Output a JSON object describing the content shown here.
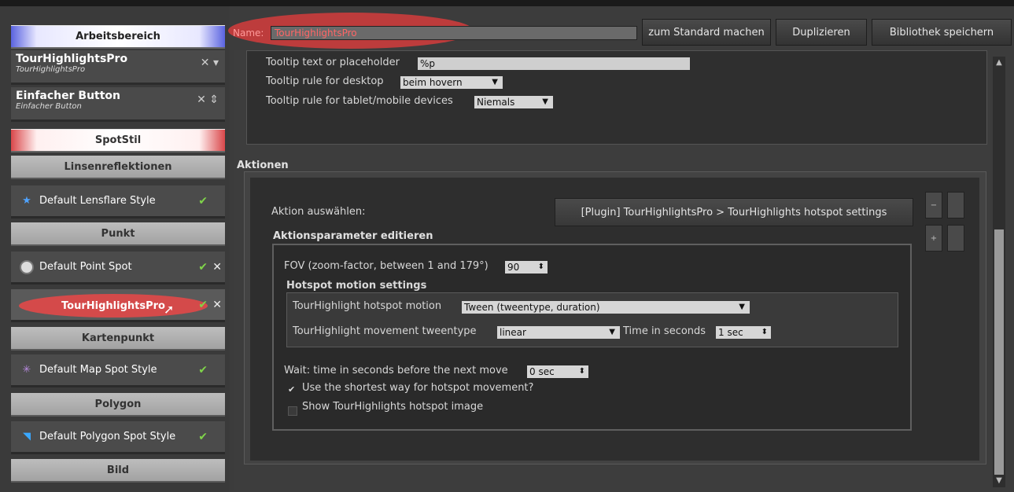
{
  "sidebar": {
    "workspace": "Arbeitsbereich",
    "libraries": [
      {
        "title": "TourHighlightsPro",
        "subtitle": "TourHighlightsPro"
      },
      {
        "title": "Einfacher Button",
        "subtitle": "Einfacher Button"
      }
    ],
    "spot_style": "SpotStil",
    "sections": {
      "lensflare": "Linsenreflektionen",
      "point": "Punkt",
      "mappoint": "Kartenpunkt",
      "polygon": "Polygon",
      "image": "Bild"
    },
    "styles": {
      "lensflare": "Default Lensflare Style",
      "point": "Default Point Spot",
      "active": "TourHighlightsPro",
      "map": "Default Map Spot Style",
      "polygon": "Default Polygon Spot Style"
    }
  },
  "header": {
    "name_label": "Name:",
    "name_value": "TourHighlightsPro",
    "buttons": {
      "default": "zum Standard machen",
      "duplicate": "Duplizieren",
      "save_lib": "Bibliothek speichern"
    }
  },
  "tooltip": {
    "text_label": "Tooltip text or placeholder",
    "text_value": "%p",
    "desktop_label": "Tooltip rule for desktop",
    "desktop_value": "beim hovern",
    "mobile_label": "Tooltip rule for tablet/mobile devices",
    "mobile_value": "Niemals"
  },
  "actions": {
    "title": "Aktionen",
    "select_label": "Aktion auswählen:",
    "selected_action": "[Plugin] TourHighlightsPro > TourHighlights hotspot settings",
    "params_title": "Aktionsparameter editieren",
    "fov_label": "FOV (zoom-factor, between 1 and 179°)",
    "fov_value": "90",
    "motion_title": "Hotspot motion settings",
    "motion_label": "TourHighlight hotspot motion",
    "motion_value": "Tween (tweentype, duration)",
    "tween_label": "TourHighlight movement tweentype",
    "tween_value": "linear",
    "time_label": "Time in seconds",
    "time_value": "1 sec",
    "wait_label": "Wait: time in seconds before the next move",
    "wait_value": "0 sec",
    "shortest_label": "Use the shortest way for hotspot movement?",
    "shortest_checked": true,
    "show_image_label": "Show TourHighlights hotspot image",
    "show_image_checked": false
  },
  "colors": {
    "accent_red": "#d33c3c",
    "check_green": "#7fd34a",
    "workspace_blue": "#5a63e0"
  }
}
